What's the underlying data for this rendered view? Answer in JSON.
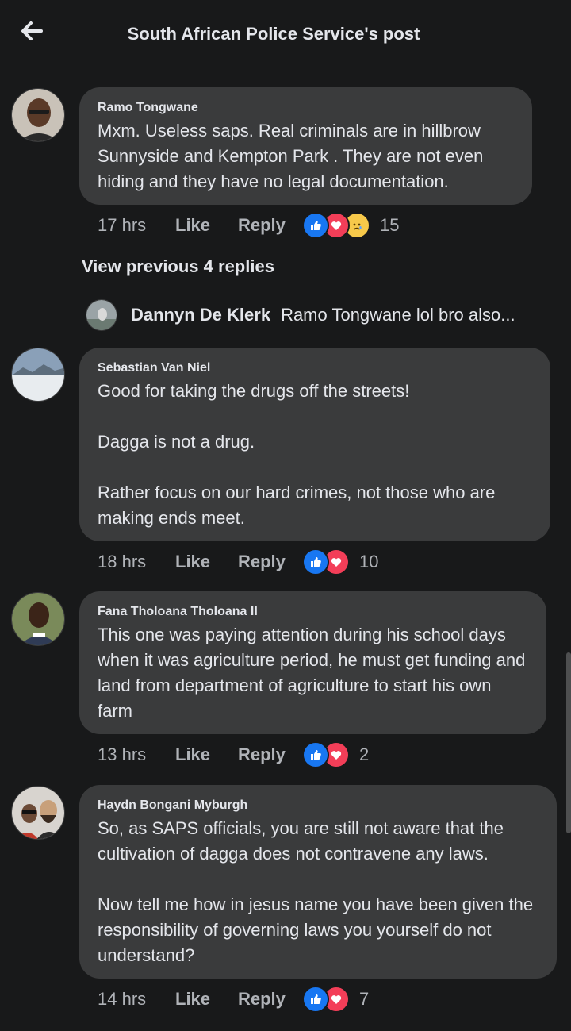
{
  "header": {
    "title": "South African Police Service's post",
    "back_icon": "back-arrow-icon"
  },
  "labels": {
    "like": "Like",
    "reply": "Reply"
  },
  "comments": [
    {
      "author": "Ramo Tongwane",
      "text": "Mxm. Useless saps. Real criminals are in hillbrow Sunnyside and Kempton Park . They are not even hiding and they have no legal documentation.",
      "time": "17 hrs",
      "reactions": [
        "like",
        "love",
        "sad"
      ],
      "reaction_count": "15"
    },
    {
      "author": "Sebastian Van Niel",
      "text": "Good for taking the drugs off the streets!\n\nDagga is not a drug.\n\nRather focus on our hard crimes, not those who are making ends meet.",
      "time": "18 hrs",
      "reactions": [
        "like",
        "love"
      ],
      "reaction_count": "10"
    },
    {
      "author": "Fana Tholoana Tholoana II",
      "text": "This one was paying attention during his school days when it was agriculture period, he must get funding and land from department of agriculture to start his own farm",
      "time": "13 hrs",
      "reactions": [
        "like",
        "love"
      ],
      "reaction_count": "2"
    },
    {
      "author": "Haydn Bongani Myburgh",
      "text": "So, as SAPS officials, you are still not aware that the cultivation of dagga does not contravene any laws.\n\nNow tell me how in jesus name you have been given the responsibility of governing laws you yourself do not understand?",
      "time": "14 hrs",
      "reactions": [
        "like",
        "love"
      ],
      "reaction_count": "7"
    }
  ],
  "replies_thread": {
    "view_previous": "View previous 4 replies",
    "latest_reply_author": "Dannyn De Klerk",
    "latest_reply_text": "Ramo Tongwane lol bro also..."
  },
  "colors": {
    "background": "#18191a",
    "bubble": "#3a3b3c",
    "secondary_text": "#b0b3b8",
    "like_reaction": "#1877f2",
    "love_reaction": "#f33e58",
    "sad_reaction": "#f7c94a"
  }
}
